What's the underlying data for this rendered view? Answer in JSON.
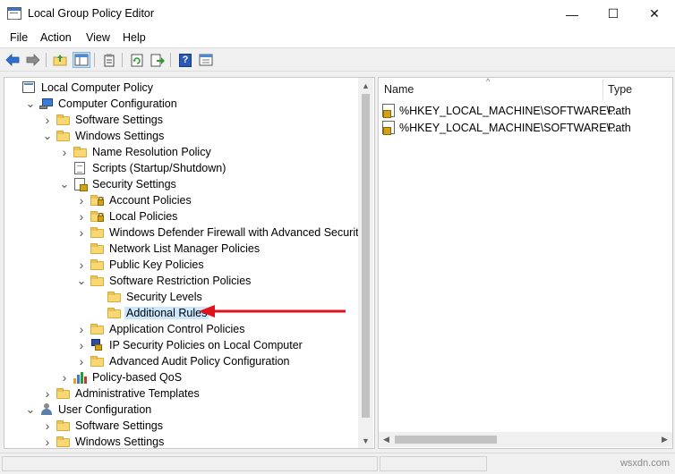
{
  "window": {
    "title": "Local Group Policy Editor",
    "minimize_glyph": "—",
    "maximize_glyph": "☐",
    "close_glyph": "✕"
  },
  "menu": [
    "File",
    "Action",
    "View",
    "Help"
  ],
  "toolbar": {
    "back": "back-arrow-icon",
    "forward": "forward-arrow-icon",
    "up": "up-folder-icon",
    "show_hide_tree": "show-hide-tree-icon",
    "properties": "properties-icon",
    "refresh": "refresh-icon",
    "export": "export-list-icon",
    "help": "help-icon",
    "help_glyph": "?",
    "view": "view-icon"
  },
  "tree": [
    {
      "label": "Local Computer Policy",
      "icon": "policy-icon",
      "chevron": ""
    },
    {
      "label": "Computer Configuration",
      "icon": "computer-icon",
      "chevron": "expanded"
    },
    {
      "label": "Software Settings",
      "icon": "folder-icon",
      "chevron": "collapsed"
    },
    {
      "label": "Windows Settings",
      "icon": "folder-icon",
      "chevron": "expanded"
    },
    {
      "label": "Name Resolution Policy",
      "icon": "folder-icon",
      "chevron": "collapsed"
    },
    {
      "label": "Scripts (Startup/Shutdown)",
      "icon": "script-icon",
      "chevron": ""
    },
    {
      "label": "Security Settings",
      "icon": "security-settings-icon",
      "chevron": "expanded"
    },
    {
      "label": "Account Policies",
      "icon": "locked-folder-icon",
      "chevron": "collapsed"
    },
    {
      "label": "Local Policies",
      "icon": "locked-folder-icon",
      "chevron": "collapsed"
    },
    {
      "label": "Windows Defender Firewall with Advanced Security",
      "icon": "folder-icon",
      "chevron": "collapsed"
    },
    {
      "label": "Network List Manager Policies",
      "icon": "folder-icon",
      "chevron": ""
    },
    {
      "label": "Public Key Policies",
      "icon": "folder-icon",
      "chevron": "collapsed"
    },
    {
      "label": "Software Restriction Policies",
      "icon": "folder-icon",
      "chevron": "expanded"
    },
    {
      "label": "Security Levels",
      "icon": "folder-icon",
      "chevron": ""
    },
    {
      "label": "Additional Rules",
      "icon": "folder-icon",
      "chevron": "",
      "selected": true
    },
    {
      "label": "Application Control Policies",
      "icon": "folder-icon",
      "chevron": "collapsed"
    },
    {
      "label": "IP Security Policies on Local Computer",
      "icon": "ip-security-icon",
      "chevron": "collapsed"
    },
    {
      "label": "Advanced Audit Policy Configuration",
      "icon": "folder-icon",
      "chevron": "collapsed"
    },
    {
      "label": "Policy-based QoS",
      "icon": "qos-chart-icon",
      "chevron": "collapsed"
    },
    {
      "label": "Administrative Templates",
      "icon": "folder-icon",
      "chevron": "collapsed"
    },
    {
      "label": "User Configuration",
      "icon": "user-icon",
      "chevron": "expanded"
    },
    {
      "label": "Software Settings",
      "icon": "folder-icon",
      "chevron": "collapsed"
    },
    {
      "label": "Windows Settings",
      "icon": "folder-icon",
      "chevron": "collapsed"
    }
  ],
  "list": {
    "columns": [
      "Name",
      "Type"
    ],
    "sort_indicator": "^",
    "rows": [
      {
        "name": "%HKEY_LOCAL_MACHINE\\SOFTWARE\\...",
        "type": "Path",
        "icon": "registry-path-icon"
      },
      {
        "name": "%HKEY_LOCAL_MACHINE\\SOFTWARE\\...",
        "type": "Path",
        "icon": "registry-path-icon"
      }
    ]
  },
  "scrollbars": {
    "up": "▲",
    "down": "▼",
    "left": "◀",
    "right": "▶"
  },
  "annotation": {
    "color": "#e0121c"
  },
  "watermark": "wsxdn.com"
}
